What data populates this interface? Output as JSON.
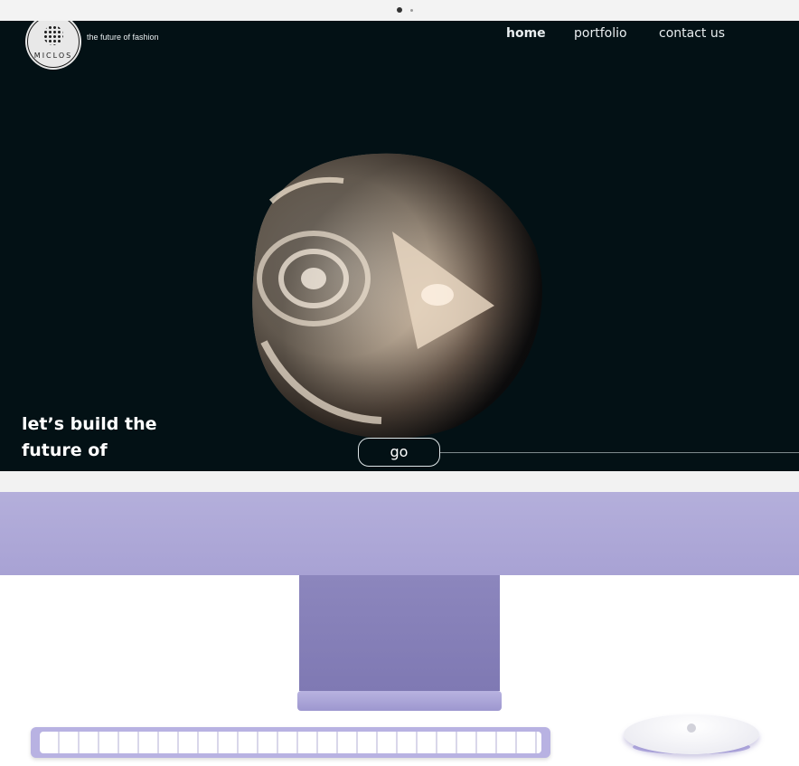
{
  "site": {
    "logo_text": "MICLOS",
    "tagline": "the future of fashion"
  },
  "nav": {
    "home": "home",
    "portfolio": "portfolio",
    "contact": "contact us"
  },
  "hero": {
    "line1": "let’s build the",
    "line2": "future of",
    "button": "go"
  },
  "colors": {
    "screen_bg": "#031115",
    "accent_purple": "#a8a2d4",
    "text": "#ffffff"
  },
  "icons": [
    "apple-icon"
  ]
}
